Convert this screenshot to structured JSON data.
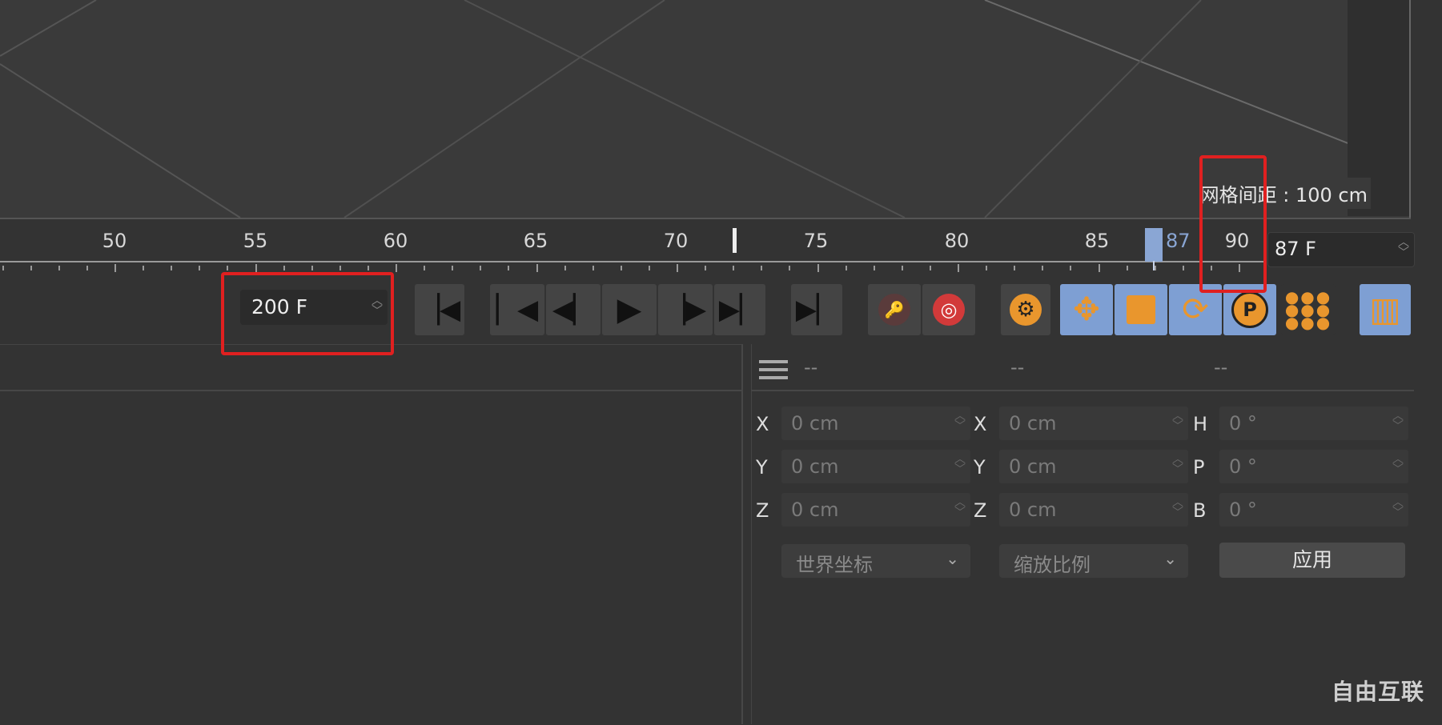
{
  "viewport": {
    "grid_spacing_label": "网格间距 : 100 cm"
  },
  "timeline": {
    "ruler_labels": [
      "50",
      "55",
      "60",
      "65",
      "70",
      "75",
      "80",
      "85",
      "90"
    ],
    "current_frame_marker": "87",
    "current_frame_field": "87 F",
    "end_frame_field": "200 F"
  },
  "transport": {
    "buttons": [
      "go-to-start",
      "go-to-previous-key",
      "previous-frame",
      "play",
      "next-frame",
      "go-to-next-key",
      "go-to-end",
      "record-disabled",
      "autokey",
      "keyframe-settings",
      "move",
      "scale",
      "rotate",
      "parameter",
      "point-level",
      "animation-layout"
    ]
  },
  "coordinates": {
    "header_dashes": [
      "--",
      "--",
      "--"
    ],
    "rows": [
      {
        "pos_label": "X",
        "pos": "0 cm",
        "size_label": "X",
        "size": "0 cm",
        "rot_label": "H",
        "rot": "0 °"
      },
      {
        "pos_label": "Y",
        "pos": "0 cm",
        "size_label": "Y",
        "size": "0 cm",
        "rot_label": "P",
        "rot": "0 °"
      },
      {
        "pos_label": "Z",
        "pos": "0 cm",
        "size_label": "Z",
        "size": "0 cm",
        "rot_label": "B",
        "rot": "0 °"
      }
    ],
    "dropdown_world": "世界坐标",
    "dropdown_scale": "缩放比例",
    "apply_label": "应用"
  },
  "watermark": "自由互联",
  "colors": {
    "accent_blue": "#7e9fd3",
    "orange": "#e9962d",
    "red": "#d23a3a",
    "annotation_red": "#e02020"
  }
}
